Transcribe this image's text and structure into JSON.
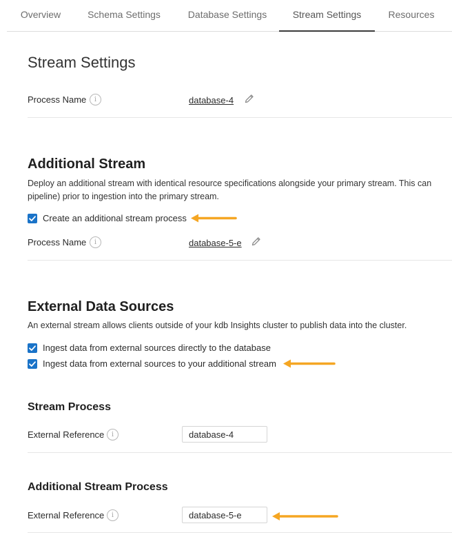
{
  "tabs": [
    {
      "label": "Overview"
    },
    {
      "label": "Schema Settings"
    },
    {
      "label": "Database Settings"
    },
    {
      "label": "Stream Settings"
    },
    {
      "label": "Resources"
    }
  ],
  "active_tab": "Stream Settings",
  "page_title": "Stream Settings",
  "primary": {
    "process_name_label": "Process Name",
    "process_name_value": "database-4"
  },
  "additional_stream": {
    "title": "Additional Stream",
    "desc_line1": "Deploy an additional stream with identical resource specifications alongside your primary stream. This can",
    "desc_line2": "pipeline) prior to ingestion into the primary stream.",
    "checkbox_label": "Create an additional stream process",
    "checkbox_checked": true,
    "process_name_label": "Process Name",
    "process_name_value": "database-5-e"
  },
  "external": {
    "title": "External Data Sources",
    "desc": "An external stream allows clients outside of your kdb Insights cluster to publish data into the cluster.",
    "checkbox1_label": "Ingest data from external sources directly to the database",
    "checkbox1_checked": true,
    "checkbox2_label": "Ingest data from external sources to your additional stream",
    "checkbox2_checked": true
  },
  "stream_process": {
    "title": "Stream Process",
    "ext_ref_label": "External Reference",
    "ext_ref_value": "database-4"
  },
  "additional_stream_process": {
    "title": "Additional Stream Process",
    "ext_ref_label": "External Reference",
    "ext_ref_value": "database-5-e"
  },
  "colors": {
    "accent_checkbox": "#1a73c8",
    "annotation_arrow": "#f5a623"
  },
  "icons": {
    "info": "info-icon",
    "edit": "pencil-icon",
    "check": "check-icon",
    "annotation": "arrow-left-icon"
  }
}
